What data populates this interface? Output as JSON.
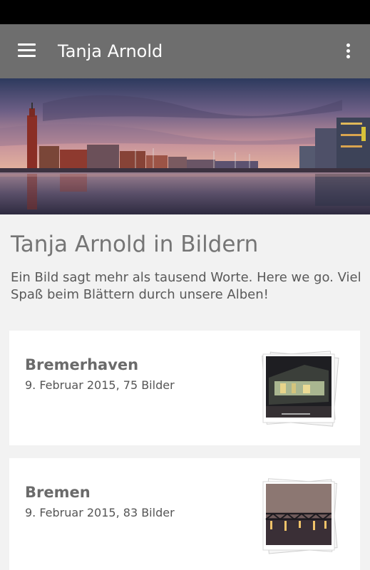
{
  "app_bar": {
    "title": "Tanja Arnold",
    "menu_icon": "menu-icon",
    "overflow_icon": "more-vert-icon"
  },
  "header": {
    "hero_image": "harbor-panorama",
    "title": "Tanja Arnold in Bildern",
    "intro": "Ein Bild sagt mehr als tausend Worte. Here we go. Viel Spaß beim Blättern durch unsere Alben!"
  },
  "albums": [
    {
      "name": "Bremerhaven",
      "meta": "9. Februar 2015, 75 Bilder",
      "thumbnail": "night-building-photo-stack"
    },
    {
      "name": "Bremen",
      "meta": "9. Februar 2015, 83 Bilder",
      "thumbnail": "bridge-photo-stack"
    }
  ],
  "colors": {
    "status_bar": "#000000",
    "app_bar": "#6e6e6e",
    "background": "#f2f2f2",
    "card": "#ffffff"
  }
}
